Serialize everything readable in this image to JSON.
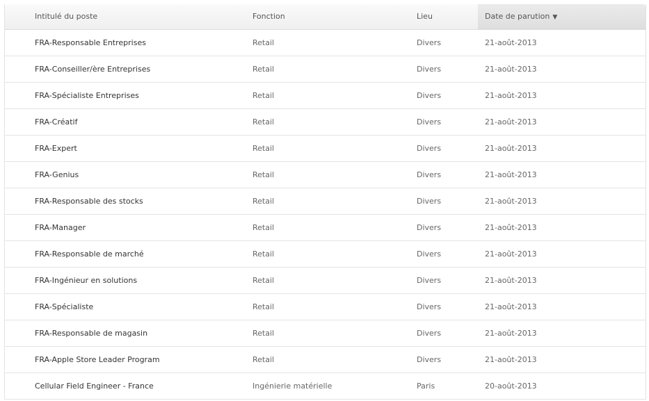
{
  "table": {
    "columns": [
      "Intitulé du poste",
      "Fonction",
      "Lieu",
      "Date de parution"
    ],
    "sorted_column": 3,
    "sort_direction_icon": "▼",
    "rows": [
      [
        "FRA-Responsable Entreprises",
        "Retail",
        "Divers",
        "21-août-2013"
      ],
      [
        "FRA-Conseiller/ère Entreprises",
        "Retail",
        "Divers",
        "21-août-2013"
      ],
      [
        "FRA-Spécialiste Entreprises",
        "Retail",
        "Divers",
        "21-août-2013"
      ],
      [
        "FRA-Créatif",
        "Retail",
        "Divers",
        "21-août-2013"
      ],
      [
        "FRA-Expert",
        "Retail",
        "Divers",
        "21-août-2013"
      ],
      [
        "FRA-Genius",
        "Retail",
        "Divers",
        "21-août-2013"
      ],
      [
        "FRA-Responsable des stocks",
        "Retail",
        "Divers",
        "21-août-2013"
      ],
      [
        "FRA-Manager",
        "Retail",
        "Divers",
        "21-août-2013"
      ],
      [
        "FRA-Responsable de marché",
        "Retail",
        "Divers",
        "21-août-2013"
      ],
      [
        "FRA-Ingénieur en solutions",
        "Retail",
        "Divers",
        "21-août-2013"
      ],
      [
        "FRA-Spécialiste",
        "Retail",
        "Divers",
        "21-août-2013"
      ],
      [
        "FRA-Responsable de magasin",
        "Retail",
        "Divers",
        "21-août-2013"
      ],
      [
        "FRA-Apple Store Leader Program",
        "Retail",
        "Divers",
        "21-août-2013"
      ],
      [
        "Cellular Field Engineer - France",
        "Ingénierie matérielle",
        "Paris",
        "20-août-2013"
      ]
    ]
  }
}
